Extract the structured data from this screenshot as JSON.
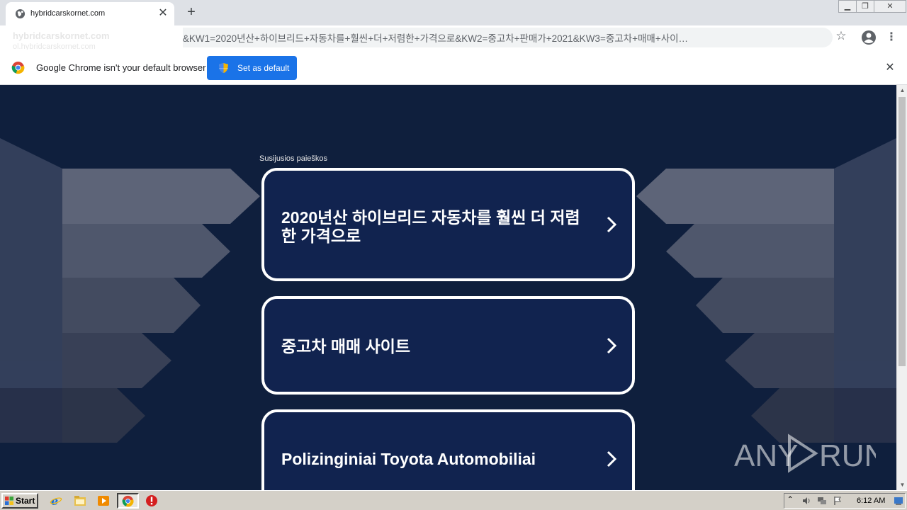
{
  "browser": {
    "tab_title": "hybridcarskornet.com",
    "new_tab_symbol": "+",
    "hovercard_title": "hybridcarskornet.com",
    "hovercard_subtitle": "ol.hybridcarskornet.com",
    "url": "t.com/?backfill=0&KW1=2020년산+하이브리드+자동차를+훨씬+더+저렴한+가격으로&KW2=중고차+판매가+2021&KW3=중고차+매매+사이…",
    "infobar_message": "Google Chrome isn't your default browser",
    "set_default_label": "Set as default"
  },
  "page": {
    "related_label": "Susijusios paieškos",
    "cards": [
      {
        "label": "2020년산 하이브리드 자동차를 훨씬 더 저렴한 가격으로"
      },
      {
        "label": "중고차 매매 사이트"
      },
      {
        "label": "Polizinginiai Toyota Automobiliai"
      }
    ]
  },
  "watermark": {
    "text": "ANY RUN"
  },
  "taskbar": {
    "start_label": "Start",
    "clock": "6:12 AM"
  },
  "colors": {
    "page_bg": "#0f1f3d",
    "card_bg": "#11234f",
    "accent_button": "#1a73e8"
  }
}
